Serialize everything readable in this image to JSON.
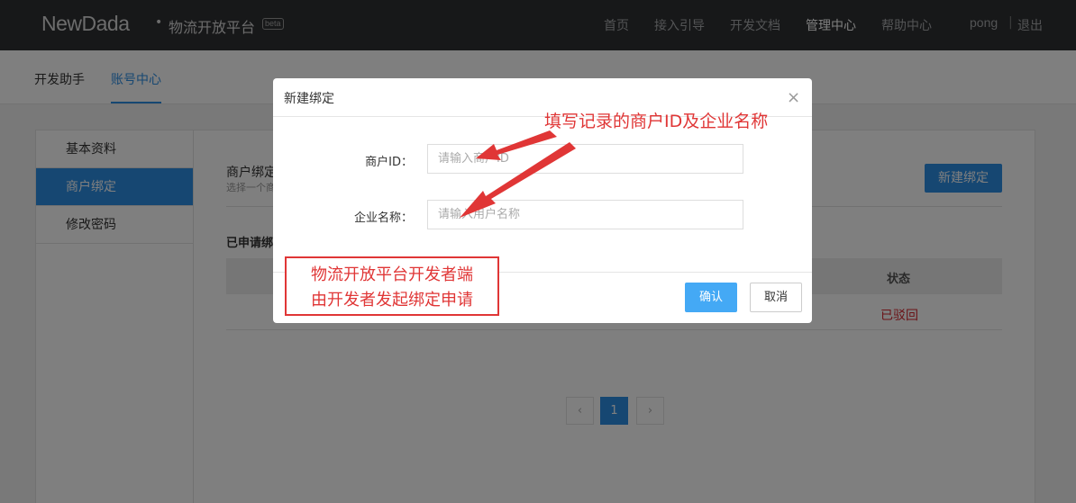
{
  "header": {
    "logo": "NewDada",
    "dot": "•",
    "platform": "物流开放平台",
    "beta": "beta",
    "nav": [
      "首页",
      "接入引导",
      "开发文档",
      "管理中心",
      "帮助中心"
    ],
    "user": "pong",
    "separator": "|",
    "logout": "退出"
  },
  "subnav": {
    "tabs": [
      "开发助手",
      "账号中心"
    ]
  },
  "sidebar": {
    "items": [
      "基本资料",
      "商户绑定",
      "修改密码"
    ]
  },
  "main": {
    "section_title": "商户绑定",
    "section_sub": "选择一个商",
    "new_button": "新建绑定",
    "applied_title": "已申请绑",
    "table_header_status": "状态",
    "row_status": "已驳回",
    "pager": {
      "prev": "‹",
      "current": "1",
      "next": "›"
    }
  },
  "modal": {
    "title": "新建绑定",
    "close": "×",
    "merchant_id_label": "商户ID：",
    "merchant_id_placeholder": "请输入商户ID",
    "company_label": "企业名称：",
    "company_placeholder": "请输入用户名称",
    "ok": "确认",
    "cancel": "取消"
  },
  "annotations": {
    "top_note": "填写记录的商户ID及企业名称",
    "box_line1": "物流开放平台开发者端",
    "box_line2": "由开发者发起绑定申请",
    "color": "#e03636"
  },
  "colors": {
    "accent": "#2d8ee4",
    "topbar": "#2e3033",
    "danger": "#d6262e"
  }
}
